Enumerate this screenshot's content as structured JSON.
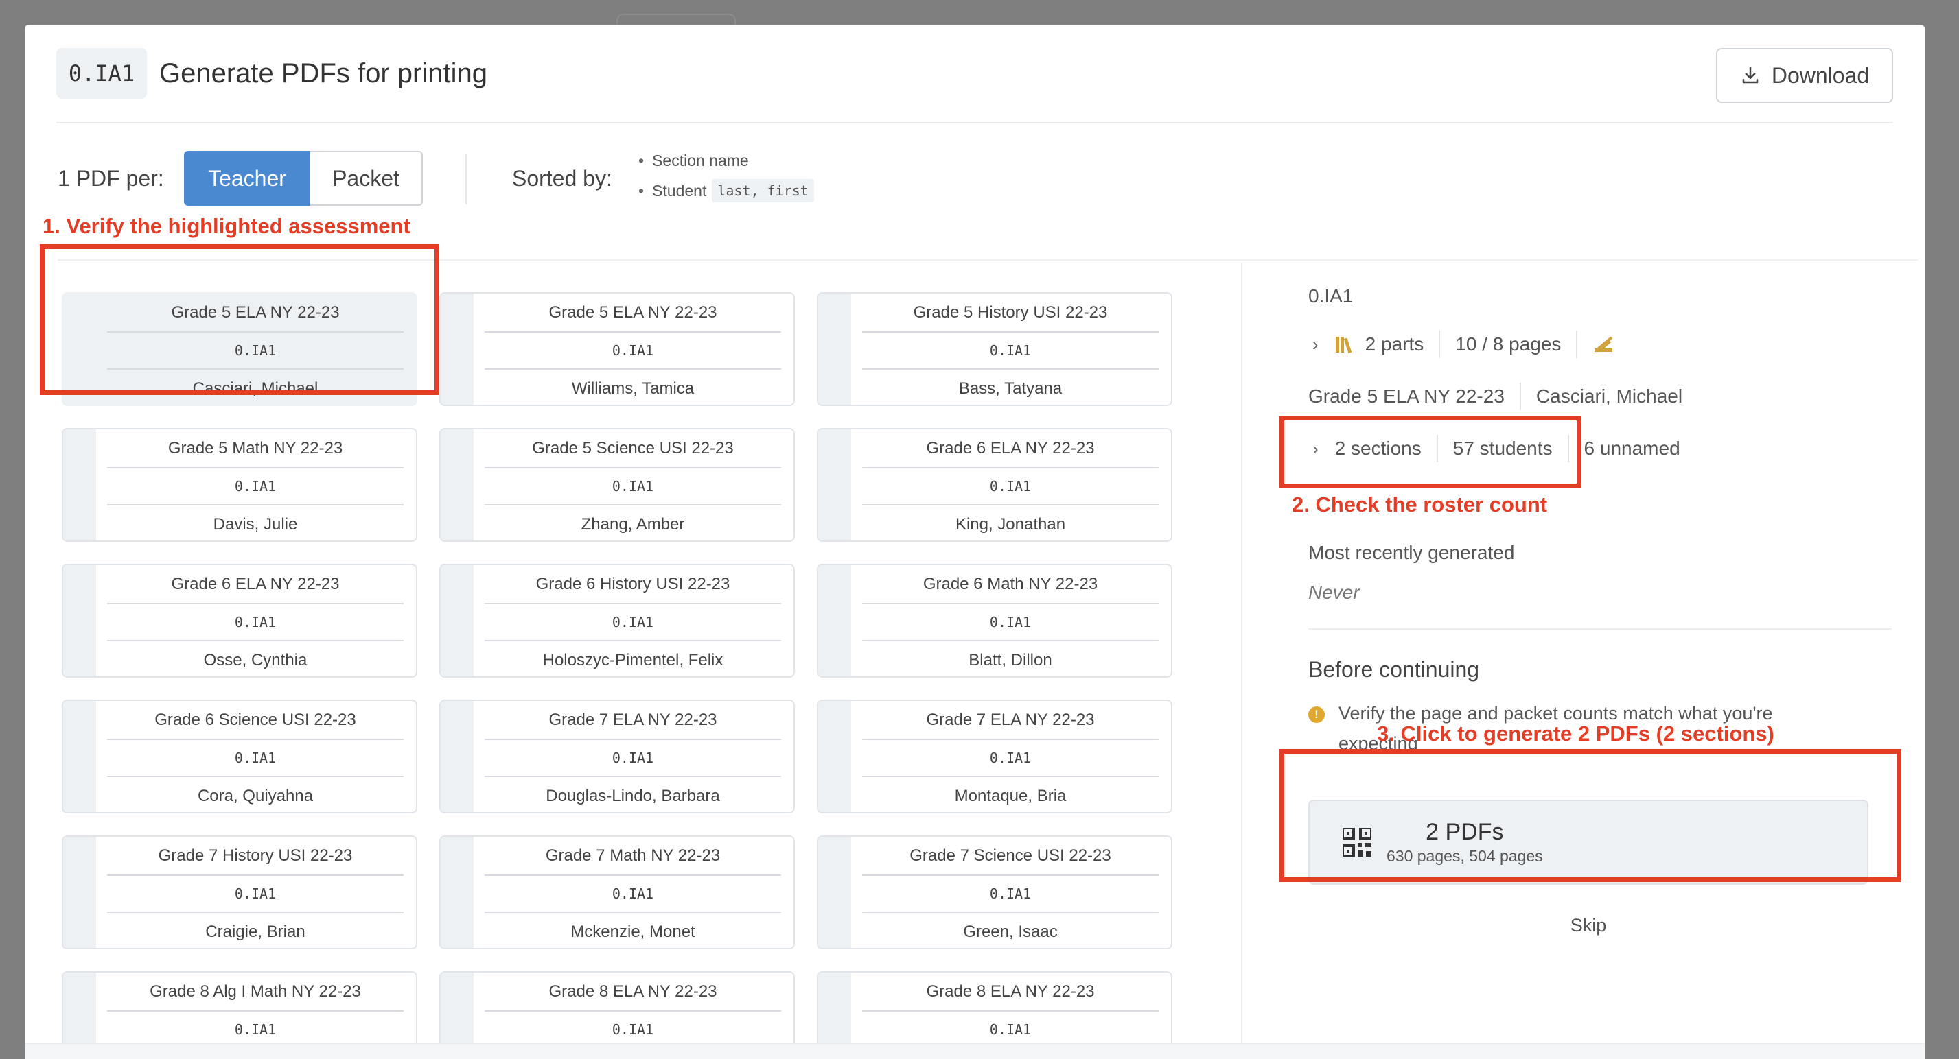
{
  "modal": {
    "code": "0.IA1",
    "title": "Generate PDFs for printing",
    "download_label": "Download"
  },
  "options": {
    "pdf_per_label": "1 PDF per:",
    "segments": [
      {
        "label": "Teacher",
        "active": true
      },
      {
        "label": "Packet",
        "active": false
      }
    ],
    "sorted_label": "Sorted by:",
    "sort_items": [
      {
        "text": "Section name",
        "code": ""
      },
      {
        "text": "Student",
        "code": "last, first"
      }
    ]
  },
  "annotations": {
    "step1": "1. Verify the highlighted assessment",
    "step2": "2. Check the roster count",
    "step3": "3. Click to generate 2 PDFs (2 sections)"
  },
  "cards": [
    {
      "title": "Grade 5 ELA NY 22-23",
      "code": "0.IA1",
      "teacher": "Casciari, Michael",
      "selected": true
    },
    {
      "title": "Grade 5 ELA NY 22-23",
      "code": "0.IA1",
      "teacher": "Williams, Tamica"
    },
    {
      "title": "Grade 5 History USI 22-23",
      "code": "0.IA1",
      "teacher": "Bass, Tatyana"
    },
    {
      "title": "Grade 5 Math NY 22-23",
      "code": "0.IA1",
      "teacher": "Davis, Julie"
    },
    {
      "title": "Grade 5 Science USI 22-23",
      "code": "0.IA1",
      "teacher": "Zhang, Amber"
    },
    {
      "title": "Grade 6 ELA NY 22-23",
      "code": "0.IA1",
      "teacher": "King, Jonathan"
    },
    {
      "title": "Grade 6 ELA NY 22-23",
      "code": "0.IA1",
      "teacher": "Osse, Cynthia"
    },
    {
      "title": "Grade 6 History USI 22-23",
      "code": "0.IA1",
      "teacher": "Holoszyc-Pimentel, Felix"
    },
    {
      "title": "Grade 6 Math NY 22-23",
      "code": "0.IA1",
      "teacher": "Blatt, Dillon"
    },
    {
      "title": "Grade 6 Science USI 22-23",
      "code": "0.IA1",
      "teacher": "Cora, Quiyahna"
    },
    {
      "title": "Grade 7 ELA NY 22-23",
      "code": "0.IA1",
      "teacher": "Douglas-Lindo, Barbara"
    },
    {
      "title": "Grade 7 ELA NY 22-23",
      "code": "0.IA1",
      "teacher": "Montaque, Bria"
    },
    {
      "title": "Grade 7 History USI 22-23",
      "code": "0.IA1",
      "teacher": "Craigie, Brian"
    },
    {
      "title": "Grade 7 Math NY 22-23",
      "code": "0.IA1",
      "teacher": "Mckenzie, Monet"
    },
    {
      "title": "Grade 7 Science USI 22-23",
      "code": "0.IA1",
      "teacher": "Green, Isaac"
    },
    {
      "title": "Grade 8 Alg I Math NY 22-23",
      "code": "0.IA1",
      "teacher": ""
    },
    {
      "title": "Grade 8 ELA NY 22-23",
      "code": "0.IA1",
      "teacher": ""
    },
    {
      "title": "Grade 8 ELA NY 22-23",
      "code": "0.IA1",
      "teacher": ""
    }
  ],
  "side": {
    "code": "0.IA1",
    "parts": "2 parts",
    "pages": "10 / 8 pages",
    "assessment": "Grade 5 ELA NY 22-23",
    "teacher": "Casciari, Michael",
    "sections": "2 sections",
    "students": "57 students",
    "unnamed": "6 unnamed",
    "recent_label": "Most recently generated",
    "recent_value": "Never",
    "before_title": "Before continuing",
    "warning": "Verify the page and packet counts match what you're expecting",
    "generate_title": "2 PDFs",
    "generate_sub": "630 pages, 504 pages",
    "skip": "Skip"
  },
  "colors": {
    "accent": "#4a89d0",
    "annotation": "#e33d26",
    "warning": "#e0a82e",
    "gold": "#d1a23a"
  },
  "icons": {
    "download": "download-icon",
    "parts": "books-icon",
    "extra": "pencil-ruler-icon",
    "generate": "qr-code-icon",
    "warning": "warning-icon",
    "chevron": "chevron-right-icon"
  }
}
